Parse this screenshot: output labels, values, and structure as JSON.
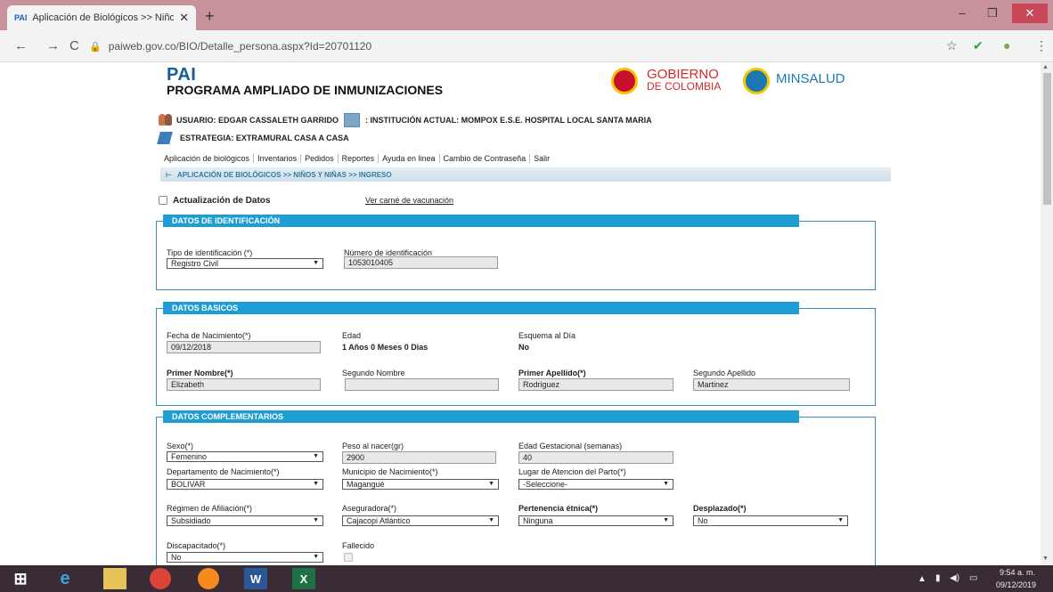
{
  "browser": {
    "tab_title": "Aplicación de Biológicos >> Niño",
    "tab_favicon": "PAI",
    "url": "paiweb.gov.co/BIO/Detalle_persona.aspx?Id=20701120"
  },
  "header": {
    "app_short": "PAI",
    "app_full": "PROGRAMA AMPLIADO DE INMUNIZACIONES",
    "logo1_line1": "GOBIERNO",
    "logo1_line2": "DE COLOMBIA",
    "logo2": "MINSALUD"
  },
  "info": {
    "usuario": "USUARIO: EDGAR CASSALETH GARRIDO",
    "institucion": ": INSTITUCIÓN ACTUAL: MOMPOX E.S.E. HOSPITAL LOCAL SANTA MARIA",
    "estrategia": "ESTRATEGIA: EXTRAMURAL CASA A CASA"
  },
  "menu": [
    "Aplicación de biológicos",
    "Inventarios",
    "Pedidos",
    "Reportes",
    "Ayuda en linea",
    "Cambio de Contraseña",
    "Salir"
  ],
  "breadcrumb": "APLICACIÓN DE BIOLÓGICOS >> NIÑOS Y NIÑAS >> INGRESO",
  "actualizacion_label": "Actualización de Datos",
  "carne_link": "Ver carné de vacunación",
  "identificacion": {
    "title": "DATOS DE IDENTIFICACIÓN",
    "tipo_label": "Tipo de identificación (*)",
    "tipo_value": "Registro Civil",
    "numero_label": "Número de identificación",
    "numero_value": "1053010405"
  },
  "basicos": {
    "title": "DATOS BASICOS",
    "fecha_label": "Fecha de Nacimiento(*)",
    "fecha_value": "09/12/2018",
    "edad_label": "Edad",
    "edad_value": "1 Años 0 Meses 0 Dias",
    "esquema_label": "Esquema al Día",
    "esquema_value": "No",
    "primer_nombre_label": "Primer Nombre(*)",
    "primer_nombre_value": "Elizabeth",
    "segundo_nombre_label": "Segundo Nombre",
    "segundo_nombre_value": "",
    "primer_apellido_label": "Primer Apellido(*)",
    "primer_apellido_value": "Rodriguez",
    "segundo_apellido_label": "Segundo Apellido",
    "segundo_apellido_value": "Martinez"
  },
  "complementarios": {
    "title": "DATOS COMPLEMENTARIOS",
    "sexo_label": "Sexo(*)",
    "sexo_value": "Femenino",
    "peso_label": "Peso al nacer(gr)",
    "peso_value": "2900",
    "edad_gest_label": "Edad Gestacional (semanas)",
    "edad_gest_value": "40",
    "depto_label": "Departamento de Nacimiento(*)",
    "depto_value": "BOLIVAR",
    "municipio_label": "Municipio de Nacimiento(*)",
    "municipio_value": "Magangué",
    "lugar_label": "Lugar de Atencion del Parto(*)",
    "lugar_value": "-Seleccione-",
    "regimen_label": "Régimen de Afiliación(*)",
    "regimen_value": "Subsidiado",
    "aseguradora_label": "Aseguradora(*)",
    "aseguradora_value": "Cajacopi Atlántico",
    "etnica_label": "Pertenencia étnica(*)",
    "etnica_value": "Ninguna",
    "desplazado_label": "Desplazado(*)",
    "desplazado_value": "No",
    "discapacitado_label": "Discapacitado(*)",
    "discapacitado_value": "No",
    "fallecido_label": "Fallecido"
  },
  "taskbar": {
    "time": "9:54 a. m.",
    "date": "09/12/2019"
  },
  "colors": {
    "section_header": "#1d9dd4",
    "tabbar": "#c8929c",
    "brand_blue": "#1a5b9a",
    "gov_red": "#d42a2a"
  }
}
